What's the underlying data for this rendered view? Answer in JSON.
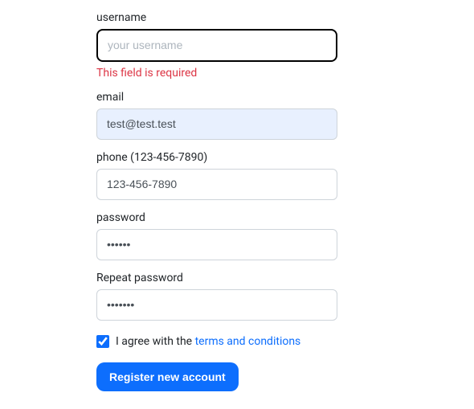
{
  "form": {
    "username": {
      "label": "username",
      "placeholder": "your username",
      "value": "",
      "error": "This field is required"
    },
    "email": {
      "label": "email",
      "placeholder": "",
      "value": "test@test.test"
    },
    "phone": {
      "label": "phone (123-456-7890)",
      "placeholder": "",
      "value": "123-456-7890"
    },
    "password": {
      "label": "password",
      "placeholder": "",
      "value": "••••••"
    },
    "repeat_password": {
      "label": "Repeat password",
      "placeholder": "",
      "value": "•••••••"
    },
    "agreement": {
      "checked": true,
      "label_prefix": "I agree with the ",
      "link_text": "terms and conditions"
    },
    "submit_label": "Register new account"
  }
}
